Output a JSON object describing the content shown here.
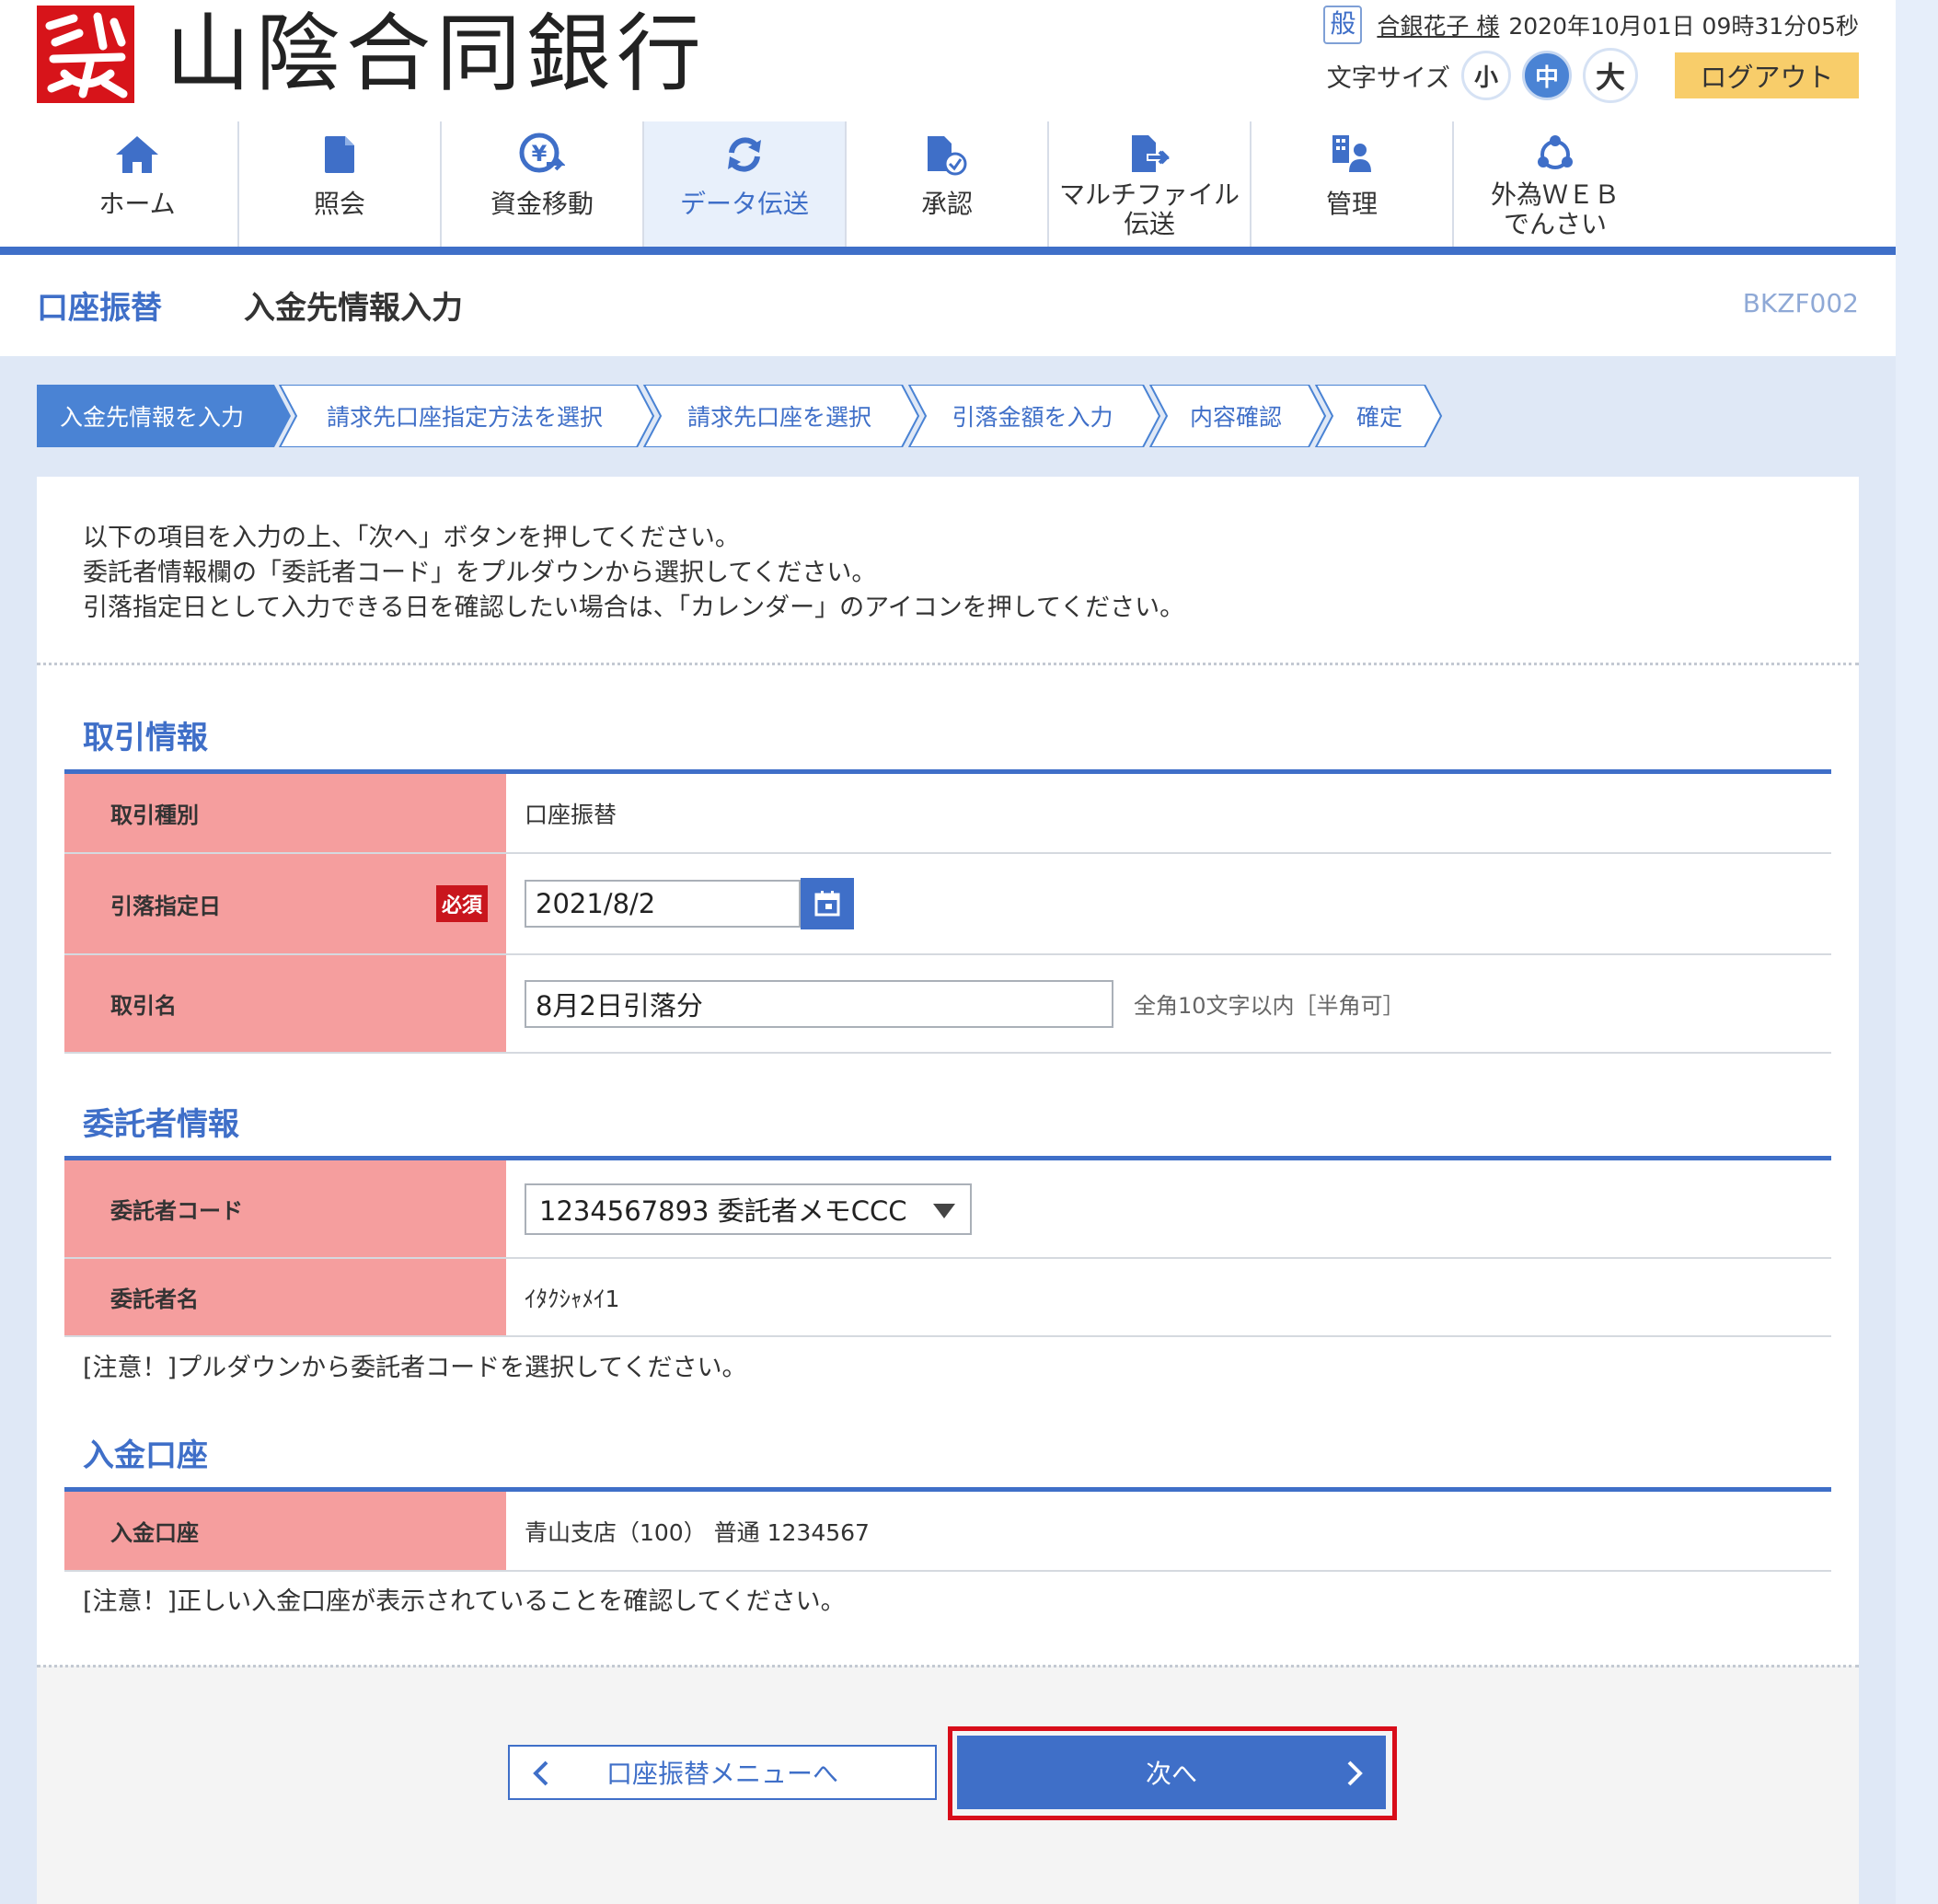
{
  "header": {
    "bank_name": "山陰合同銀行",
    "user_badge": "般",
    "user_name": "合銀花子 様",
    "datetime": "2020年10月01日 09時31分05秒",
    "font_size_label": "文字サイズ",
    "font_sizes": [
      "小",
      "中",
      "大"
    ],
    "font_size_selected": "中",
    "logout_label": "ログアウト"
  },
  "nav": [
    {
      "label": "ホーム",
      "icon": "home-icon"
    },
    {
      "label": "照会",
      "icon": "document-icon"
    },
    {
      "label": "資金移動",
      "icon": "yen-transfer-icon"
    },
    {
      "label": "データ伝送",
      "icon": "refresh-icon"
    },
    {
      "label": "承認",
      "icon": "approve-document-icon"
    },
    {
      "label": "マルチファイル\n伝送",
      "label_line1": "マルチファイル",
      "label_line2": "伝送",
      "icon": "file-send-icon"
    },
    {
      "label": "管理",
      "icon": "admin-icon"
    },
    {
      "label": "外為ＷＥＢ\nでんさい",
      "label_line1": "外為ＷＥＢ",
      "label_line2": "でんさい",
      "icon": "network-icon"
    }
  ],
  "nav_active": "データ伝送",
  "page": {
    "title_main": "口座振替",
    "title_sub": "入金先情報入力",
    "screen_code": "BKZF002"
  },
  "steps": [
    "入金先情報を入力",
    "請求先口座指定方法を選択",
    "請求先口座を選択",
    "引落金額を入力",
    "内容確認",
    "確定"
  ],
  "steps_current": "入金先情報を入力",
  "intro_lines": [
    "以下の項目を入力の上、「次へ」ボタンを押してください。",
    "委託者情報欄の「委託者コード」をプルダウンから選択してください。",
    "引落指定日として入力できる日を確認したい場合は、「カレンダー」のアイコンを押してください。"
  ],
  "transaction": {
    "section_title": "取引情報",
    "type_label": "取引種別",
    "type_value": "口座振替",
    "date_label": "引落指定日",
    "required_label": "必須",
    "date_value": "2021/8/2",
    "name_label": "取引名",
    "name_value": "8月2日引落分",
    "name_hint": "全角10文字以内［半角可］"
  },
  "consignor": {
    "section_title": "委託者情報",
    "code_label": "委託者コード",
    "code_value": "1234567893 委託者メモCCC",
    "name_label": "委託者名",
    "name_value": "ｲﾀｸｼｬﾒｲ1",
    "note": "[注意！]プルダウンから委託者コードを選択してください。"
  },
  "deposit": {
    "section_title": "入金口座",
    "account_label": "入金口座",
    "account_value": "青山支店（100） 普通 1234567",
    "note": "[注意！]正しい入金口座が表示されていることを確認してください。"
  },
  "buttons": {
    "back_label": "口座振替メニューへ",
    "next_label": "次へ"
  },
  "colors": {
    "accent_blue": "#3f6fc8",
    "label_pink": "#f59e9e",
    "required_red": "#c9161d",
    "logout_yellow": "#f8cd6a",
    "highlight_red": "#d80d1a"
  }
}
